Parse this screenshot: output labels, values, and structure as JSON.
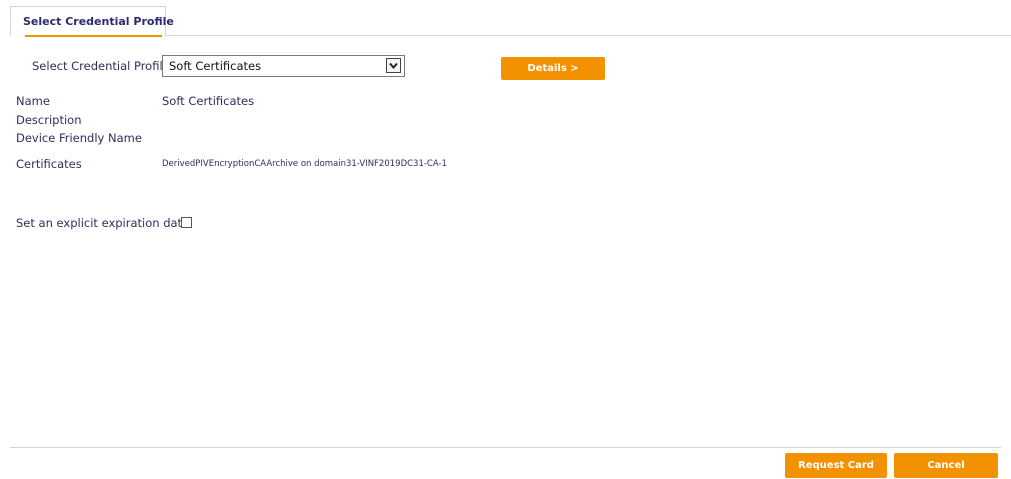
{
  "tab": {
    "label": "Select Credential Profile"
  },
  "profile_selector": {
    "label": "Select Credential Profile:",
    "selected_value": "Soft Certificates"
  },
  "buttons": {
    "details": "Details >",
    "request_card": "Request Card",
    "cancel": "Cancel"
  },
  "info": {
    "name_label": "Name",
    "name_value": "Soft Certificates",
    "description_label": "Description",
    "device_friendly_name_label": "Device Friendly Name",
    "certificates_label": "Certificates",
    "certificates_value": "DerivedPIVEncryptionCAArchive on domain31-VINF2019DC31-CA-1"
  },
  "expiration": {
    "label": "Set an explicit expiration date:",
    "checked": false
  },
  "colors": {
    "accent": "#f39200",
    "text": "#2e2e5e",
    "rule": "#d6d6d6"
  }
}
